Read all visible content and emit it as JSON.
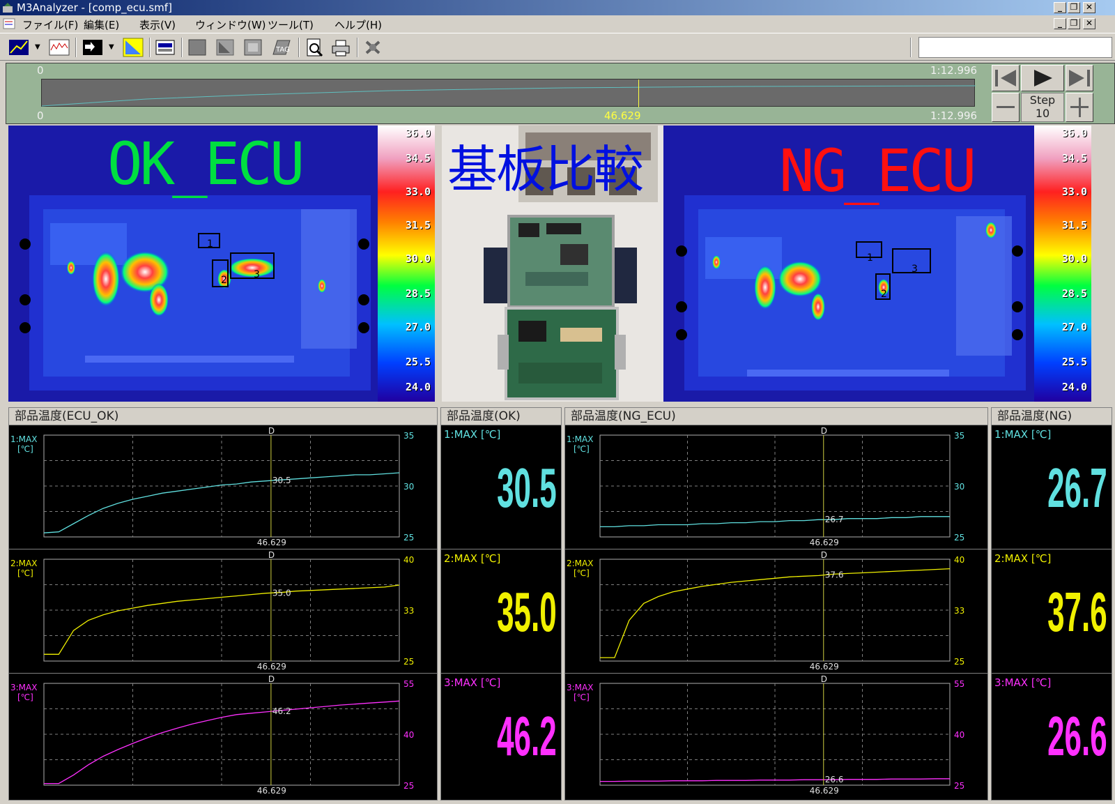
{
  "app": {
    "title": "M3Analyzer - [comp_ecu.smf]"
  },
  "window_controls": {
    "minimize": "_",
    "restore": "❐",
    "close": "✕"
  },
  "menu": [
    "ファイル(F)",
    "編集(E)",
    "表示(V)",
    "ウィンドウ(W)",
    "ツール(T)",
    "ヘルプ(H)"
  ],
  "toolbar_icons": [
    "chart-icon",
    "waveform-icon",
    "arrows-icon",
    "measure-icon",
    "record-icon",
    "square-icon",
    "frame-icon",
    "stop-icon",
    "tag-icon",
    "preview-icon",
    "print-icon",
    "plugin-icon"
  ],
  "timeline": {
    "start_top": "0",
    "end_top": "1:12.996",
    "start_bottom": "0",
    "cursor": "46.629",
    "end_bottom": "1:12.996",
    "cursor_position": 0.639,
    "step_label": "Step",
    "step_value": "10"
  },
  "thermal_left": {
    "title": "OK_ECU",
    "title_color": "#00e040",
    "scale": [
      "36.0",
      "34.5",
      "33.0",
      "31.5",
      "30.0",
      "28.5",
      "27.0",
      "25.5",
      "24.0"
    ],
    "roi": [
      "1",
      "2",
      "3"
    ]
  },
  "photo": {
    "title": "基板比較",
    "title_color": "#0010e0"
  },
  "thermal_right": {
    "title": "NG_ECU",
    "title_color": "#ff1010",
    "scale": [
      "36.0",
      "34.5",
      "33.0",
      "31.5",
      "30.0",
      "28.5",
      "27.0",
      "25.5",
      "24.0"
    ],
    "roi": [
      "1",
      "2",
      "3"
    ]
  },
  "groups": [
    {
      "title": "部品温度(ECU_OK)",
      "charts": [
        {
          "label": "1:MAX",
          "unit": "[℃]",
          "color": "#60e0e0",
          "yticks": [
            "35",
            "30",
            "25"
          ],
          "ymin": 25,
          "ymax": 35,
          "cursor_label": "D",
          "cursor_value": "46.629",
          "readout": "30.5",
          "series": [
            25.4,
            25.5,
            26.3,
            27.1,
            27.8,
            28.3,
            28.7,
            29.0,
            29.3,
            29.5,
            29.7,
            29.9,
            30.1,
            30.2,
            30.4,
            30.5,
            30.6,
            30.7,
            30.8,
            30.9,
            31.0,
            31.1,
            31.1,
            31.2,
            31.3
          ]
        },
        {
          "label": "2:MAX",
          "unit": "[℃]",
          "color": "#f0f000",
          "yticks": [
            "40",
            "33",
            "25"
          ],
          "ymin": 25,
          "ymax": 40,
          "cursor_label": "D",
          "cursor_value": "46.629",
          "readout": "35.0",
          "series": [
            26.0,
            26.0,
            29.5,
            31.0,
            31.8,
            32.4,
            32.8,
            33.2,
            33.5,
            33.8,
            34.0,
            34.2,
            34.4,
            34.6,
            34.8,
            35.0,
            35.1,
            35.3,
            35.4,
            35.5,
            35.6,
            35.7,
            35.8,
            35.9,
            36.2
          ]
        },
        {
          "label": "3:MAX",
          "unit": "[℃]",
          "color": "#ff30ff",
          "yticks": [
            "55",
            "40",
            "25"
          ],
          "ymin": 25,
          "ymax": 55,
          "cursor_label": "D",
          "cursor_value": "46.629",
          "readout": "46.2",
          "series": [
            25.5,
            25.5,
            28.0,
            31.0,
            33.5,
            35.5,
            37.3,
            39.0,
            40.5,
            41.8,
            43.0,
            44.0,
            45.0,
            45.8,
            46.2,
            46.6,
            47.0,
            47.4,
            47.8,
            48.2,
            48.6,
            48.9,
            49.2,
            49.5,
            49.8
          ]
        }
      ]
    },
    {
      "title": "部品温度(OK)",
      "values": [
        {
          "label": "1:MAX [℃]",
          "value": "30.5",
          "color": "#60e0e0"
        },
        {
          "label": "2:MAX [℃]",
          "value": "35.0",
          "color": "#f0f000"
        },
        {
          "label": "3:MAX [℃]",
          "value": "46.2",
          "color": "#ff30ff"
        }
      ]
    },
    {
      "title": "部品温度(NG_ECU)",
      "charts": [
        {
          "label": "1:MAX",
          "unit": "[℃]",
          "color": "#60e0e0",
          "yticks": [
            "35",
            "30",
            "25"
          ],
          "ymin": 25,
          "ymax": 35,
          "cursor_label": "D",
          "cursor_value": "46.629",
          "readout": "26.7",
          "series": [
            26.0,
            26.0,
            26.1,
            26.1,
            26.2,
            26.2,
            26.2,
            26.3,
            26.3,
            26.4,
            26.4,
            26.5,
            26.5,
            26.6,
            26.6,
            26.7,
            26.7,
            26.8,
            26.8,
            26.8,
            26.9,
            26.9,
            27.0,
            27.0,
            27.0
          ]
        },
        {
          "label": "2:MAX",
          "unit": "[℃]",
          "color": "#f0f000",
          "yticks": [
            "40",
            "33",
            "25"
          ],
          "ymin": 25,
          "ymax": 40,
          "cursor_label": "D",
          "cursor_value": "46.629",
          "readout": "37.6",
          "series": [
            25.5,
            25.5,
            31.0,
            33.5,
            34.5,
            35.2,
            35.6,
            36.0,
            36.3,
            36.6,
            36.8,
            37.0,
            37.2,
            37.4,
            37.5,
            37.6,
            37.8,
            37.9,
            38.0,
            38.1,
            38.2,
            38.3,
            38.4,
            38.5,
            38.6
          ]
        },
        {
          "label": "3:MAX",
          "unit": "[℃]",
          "color": "#ff30ff",
          "yticks": [
            "55",
            "40",
            "25"
          ],
          "ymin": 25,
          "ymax": 55,
          "cursor_label": "D",
          "cursor_value": "46.629",
          "readout": "26.6",
          "series": [
            26.1,
            26.1,
            26.2,
            26.2,
            26.2,
            26.3,
            26.3,
            26.3,
            26.4,
            26.4,
            26.4,
            26.5,
            26.5,
            26.5,
            26.6,
            26.6,
            26.6,
            26.7,
            26.7,
            26.7,
            26.8,
            26.8,
            26.8,
            26.9,
            26.9
          ]
        }
      ]
    },
    {
      "title": "部品温度(NG)",
      "values": [
        {
          "label": "1:MAX [℃]",
          "value": "26.7",
          "color": "#60e0e0"
        },
        {
          "label": "2:MAX [℃]",
          "value": "37.6",
          "color": "#f0f000"
        },
        {
          "label": "3:MAX [℃]",
          "value": "26.6",
          "color": "#ff30ff"
        }
      ]
    }
  ]
}
